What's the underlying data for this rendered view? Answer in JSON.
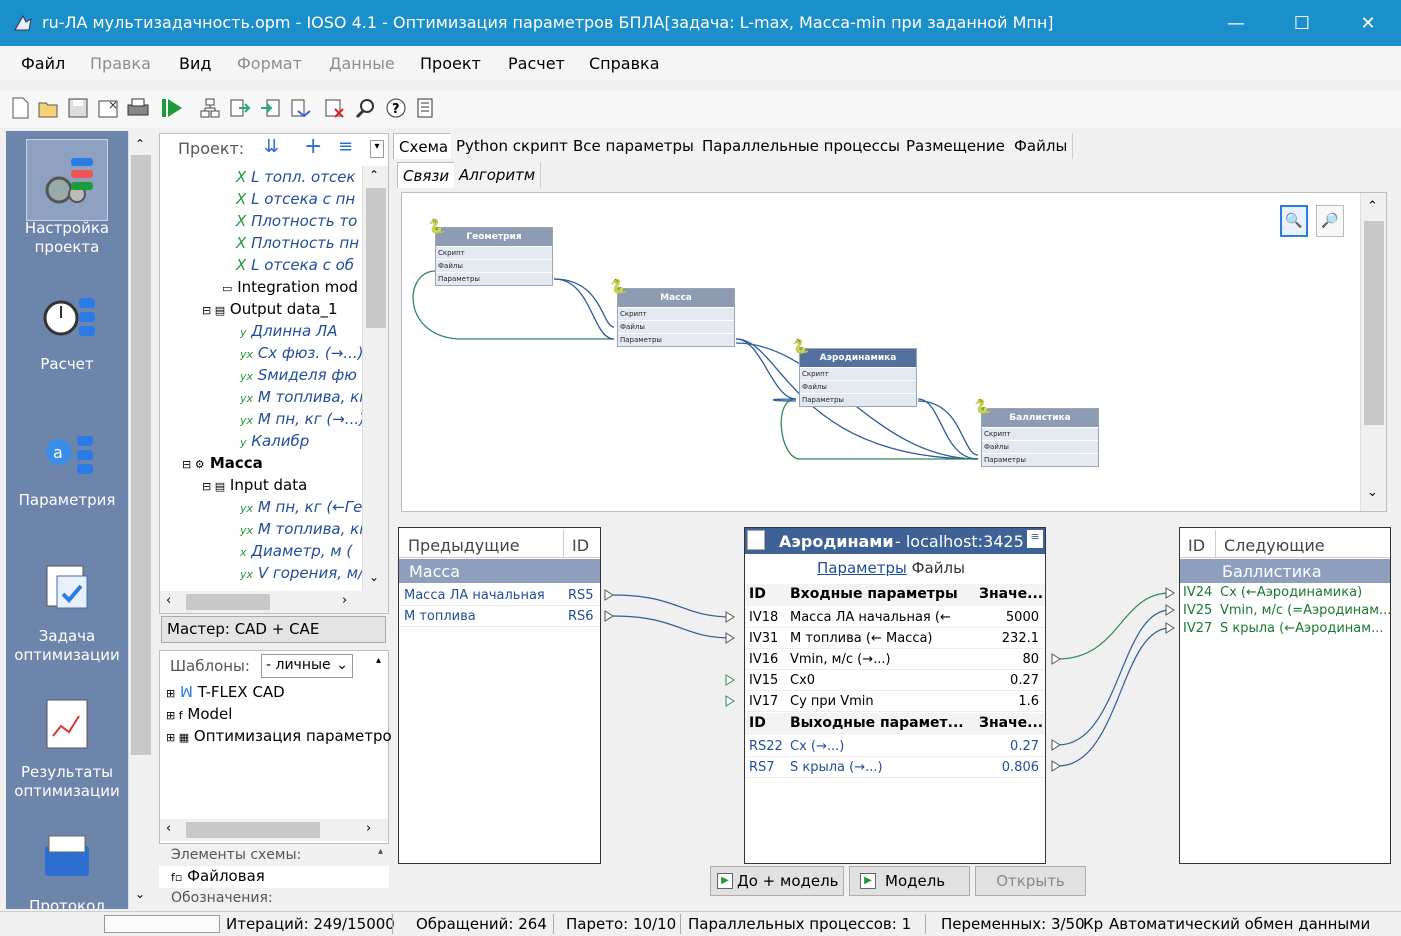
{
  "window": {
    "title": "ru-ЛА мультизадачность.opm - IOSO 4.1 - Оптимизация параметров БПЛА[задача: L-max, Масса-min при заданной Мпн]"
  },
  "menu": [
    "Файл",
    "Правка",
    "Вид",
    "Формат",
    "Данные",
    "Проект",
    "Расчет",
    "Справка"
  ],
  "menu_disabled": [
    "Правка",
    "Формат",
    "Данные"
  ],
  "toolbar_icons": [
    "new-file-icon",
    "open-file-icon",
    "save-icon",
    "save-close-icon",
    "print-icon",
    "run-icon",
    "tree-icon",
    "export-icon",
    "import-icon",
    "transfer-icon",
    "delete-icon",
    "zoom-report-icon",
    "help-icon",
    "list-icon"
  ],
  "nav": [
    {
      "label1": "Настройка",
      "label2": "проекта"
    },
    {
      "label1": "Расчет",
      "label2": ""
    },
    {
      "label1": "Параметрия",
      "label2": ""
    },
    {
      "label1": "Задача",
      "label2": "оптимизации"
    },
    {
      "label1": "Результаты",
      "label2": "оптимизации"
    },
    {
      "label1": "Протокол",
      "label2": ""
    }
  ],
  "project": {
    "label": "Проект:",
    "tree": [
      "L топл. отсек",
      "L отсека с пн",
      "Плотность то",
      "Плотность пн",
      "L  отсека с об",
      "Integration mod",
      "Output data_1",
      "Длинна ЛА",
      "Cx фюз. (→...)",
      "Sмиделя фю",
      "M топлива, кг",
      "M пн, кг (→...)",
      "Калибр",
      "Масса",
      "Input data",
      "M пн, кг (←Ге",
      "M топлива, кг",
      "Диаметр, м (",
      "V горения, м/"
    ]
  },
  "master": "Мастер: CAD + CAE",
  "templates": {
    "label": "Шаблоны:",
    "select": "- личные",
    "items": [
      "T-FLEX CAD",
      "Model",
      "Оптимизация параметро"
    ]
  },
  "scheme_elements": {
    "label": "Элементы схемы:",
    "item": "Файловая"
  },
  "designations": "Обозначения:",
  "tabs": [
    "Схема",
    "Python скрипт",
    "Все параметры",
    "Параллельные процессы",
    "Размещение",
    "Файлы"
  ],
  "subtabs": [
    "Связи",
    "Алгоритм"
  ],
  "nodes": [
    {
      "title": "Геометрия",
      "rows": [
        "Скрипт",
        "Файлы",
        "Параметры"
      ]
    },
    {
      "title": "Масса",
      "rows": [
        "Скрипт",
        "Файлы",
        "Параметры"
      ]
    },
    {
      "title": "Аэродинамика",
      "rows": [
        "Скрипт",
        "Файлы",
        "Параметры"
      ]
    },
    {
      "title": "Баллистика",
      "rows": [
        "Скрипт",
        "Файлы",
        "Параметры"
      ]
    }
  ],
  "prev": {
    "headers": [
      "Предыдущие",
      "ID"
    ],
    "group": "Масса",
    "rows": [
      [
        "Масса ЛА начальная",
        "RS5"
      ],
      [
        "M топлива",
        "RS6"
      ]
    ]
  },
  "center": {
    "title": "Аэродинами",
    "host": " - localhost:3425",
    "links": [
      "Параметры",
      "Файлы"
    ],
    "in_headers": [
      "ID",
      "Входные параметры",
      "Значе..."
    ],
    "inputs": [
      [
        "IV18",
        "Масса ЛА начальная (←",
        "5000"
      ],
      [
        "IV31",
        "M топлива (← Масса)",
        "232.1"
      ],
      [
        "IV16",
        "Vmin, м/с (→...)",
        "80"
      ],
      [
        "IV15",
        "Cx0",
        "0.27"
      ],
      [
        "IV17",
        "Cy при  Vmin",
        "1.6"
      ]
    ],
    "out_headers": [
      "ID",
      "Выходные парамет...",
      "Значе..."
    ],
    "outputs": [
      [
        "RS22",
        "Cx (→...)",
        "0.27"
      ],
      [
        "RS7",
        "S крыла (→...)",
        "0.806"
      ]
    ]
  },
  "next": {
    "headers": [
      "ID",
      "Следующие"
    ],
    "group": "Баллистика",
    "rows": [
      [
        "IV24",
        "Cx (←Аэродинамика)"
      ],
      [
        "IV25",
        "Vmin, м/с (=Аэродинам..."
      ],
      [
        "IV27",
        "S крыла (←Аэродинам..."
      ]
    ]
  },
  "buttons": {
    "pre_model": "До + модель",
    "model": "Модель",
    "open": "Открыть"
  },
  "status": {
    "iter": "Итераций: 249/15000",
    "calls": "Обращений: 264",
    "pareto": "Парето: 10/10",
    "parallel": "Параллельных процессов: 1",
    "vars": "Переменных: 3/50",
    "cr": "Кр",
    "auto": "Автоматический обмен данными"
  },
  "colors": {
    "titlebar": "#1b8fc9",
    "nav": "#6e85ab",
    "link": "#1f4e9a",
    "green": "#2e8b57",
    "group": "#8d9fbd"
  }
}
